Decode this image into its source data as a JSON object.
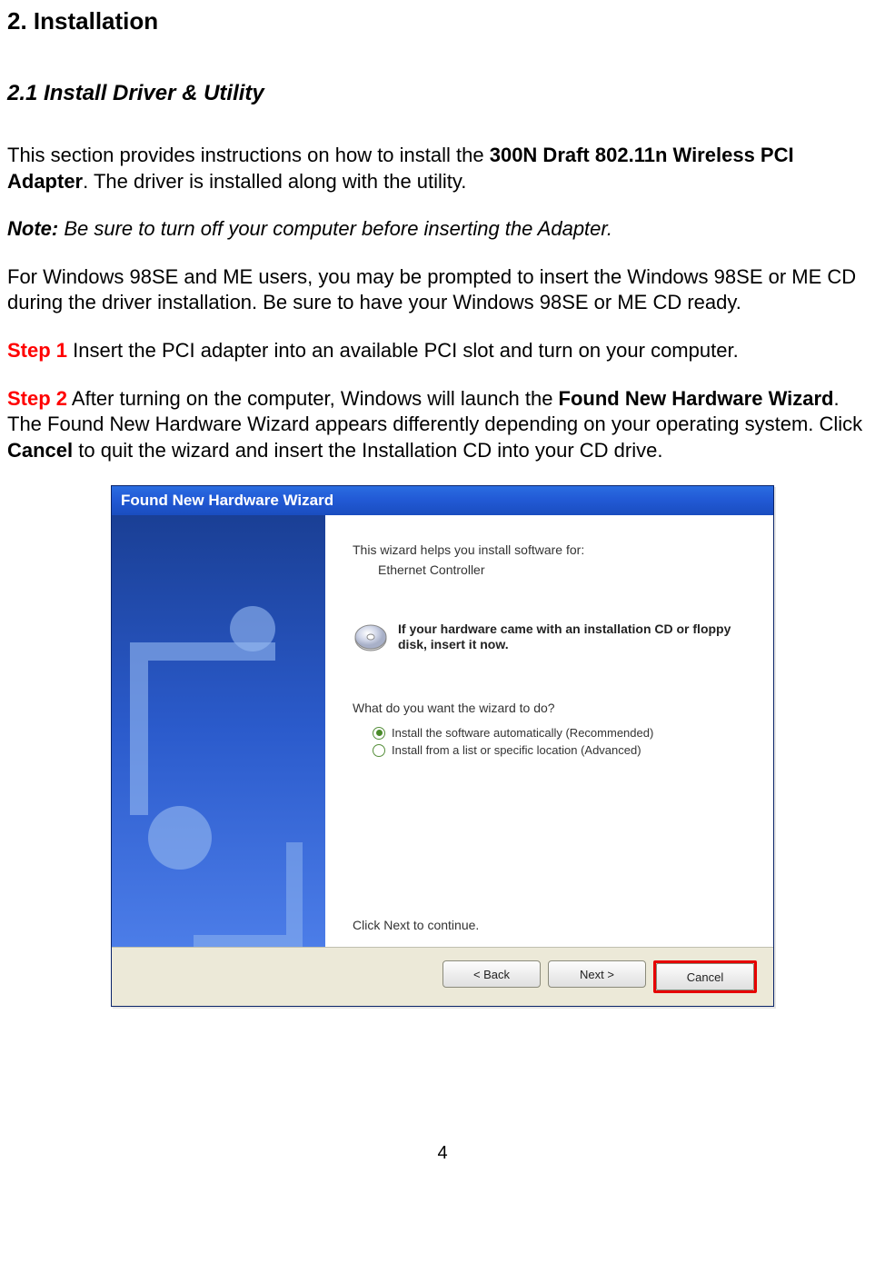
{
  "doc": {
    "h1": "2. Installation",
    "h2": "2.1 Install Driver & Utility",
    "intro_pre": "This section provides instructions on how to install the ",
    "intro_bold": "300N Draft 802.11n Wireless PCI Adapter",
    "intro_post": ". The driver is installed along with the utility.",
    "note_label": "Note:",
    "note_text": " Be sure to turn off your computer before inserting the Adapter.",
    "win98_text": "For Windows 98SE and ME users, you may be prompted to insert the Windows 98SE or ME CD during the driver installation. Be sure to have your Windows 98SE or ME CD ready.",
    "step1_label": "Step 1",
    "step1_text": " Insert the PCI adapter into an available PCI slot and turn on your computer.",
    "step2_label": "Step 2",
    "step2_text_a": " After turning on the computer, Windows will launch the ",
    "step2_bold1": "Found New Hardware Wizard",
    "step2_text_b": ". The Found New Hardware Wizard appears differently depending on your operating system. Click ",
    "step2_bold2": "Cancel",
    "step2_text_c": " to quit the wizard and insert the Installation CD into your CD drive.",
    "page_number": "4"
  },
  "wizard": {
    "title": "Found New Hardware Wizard",
    "help_text": "This wizard helps you install software for:",
    "device_name": "Ethernet Controller",
    "cd_text": "If your hardware came with an installation CD or floppy disk, insert it now.",
    "prompt": "What do you want the wizard to do?",
    "radio1": "Install the software automatically (Recommended)",
    "radio2": "Install from a list or specific location (Advanced)",
    "continue_text": "Click Next to continue.",
    "buttons": {
      "back": "< Back",
      "next": "Next >",
      "cancel": "Cancel"
    }
  }
}
